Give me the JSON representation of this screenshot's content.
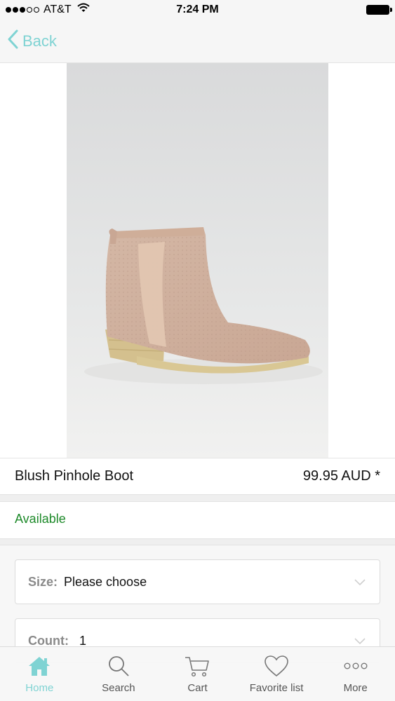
{
  "status_bar": {
    "carrier": "AT&T",
    "time": "7:24 PM"
  },
  "nav": {
    "back_label": "Back"
  },
  "product": {
    "image_icon": "ankle-boot-product-photo",
    "name": "Blush Pinhole Boot",
    "price": "99.95 AUD *",
    "availability": "Available"
  },
  "options": {
    "size": {
      "label": "Size:",
      "value": "Please choose"
    },
    "count": {
      "label": "Count:",
      "value": "1"
    }
  },
  "tabs": [
    {
      "label": "Home",
      "icon": "home-icon",
      "active": true
    },
    {
      "label": "Search",
      "icon": "search-icon",
      "active": false
    },
    {
      "label": "Cart",
      "icon": "cart-icon",
      "active": false
    },
    {
      "label": "Favorite list",
      "icon": "heart-icon",
      "active": false
    },
    {
      "label": "More",
      "icon": "more-icon",
      "active": false
    }
  ],
  "colors": {
    "accent": "#7fd3d3",
    "available_green": "#1e8a2a",
    "bar_background": "#f6f6f6"
  }
}
